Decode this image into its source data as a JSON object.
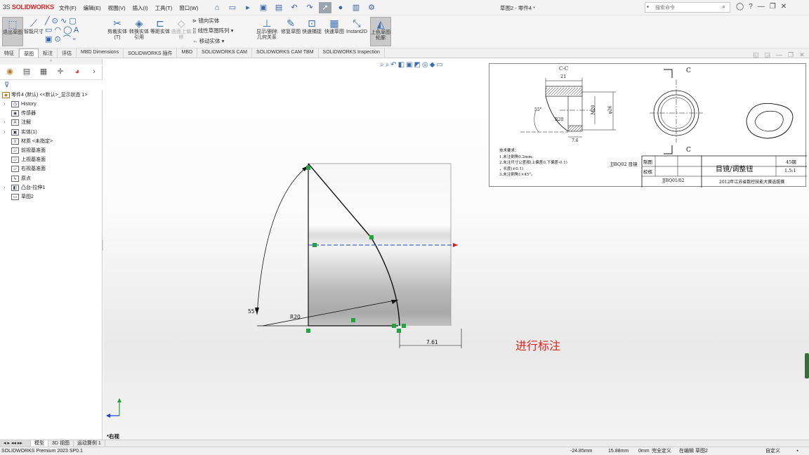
{
  "app": {
    "brand": "SOLIDWORKS",
    "logo_mark": "3S",
    "doc_title": "草图2 - 零件4 *"
  },
  "menu": [
    "文件(F)",
    "编辑(E)",
    "视图(V)",
    "插入(I)",
    "工具(T)",
    "窗口(W)"
  ],
  "search": {
    "placeholder": "搜索命令",
    "icon": "search-icon"
  },
  "ribbon": {
    "exit_sketch": "退出草图",
    "smart_dim": "智能尺寸",
    "trim": "剪裁实体(T)",
    "convert": "转换实体引用",
    "offset": "等距实体",
    "surface_offset": "曲面上偏移",
    "mirror": "镜向实体",
    "linear_array": "线性草图阵列",
    "move": "移动实体",
    "relations": "显示/删除几何关系",
    "repair": "修复草图",
    "quick_snaps": "快速捕捉",
    "rapid_sketch": "快速草图",
    "instant2d": "Instant2D",
    "shaded_contours": "上色草图轮廓"
  },
  "command_tabs": [
    "特征",
    "草图",
    "标注",
    "评估",
    "MBD Dimensions",
    "SOLIDWORKS 插件",
    "MBD",
    "SOLIDWORKS CAM",
    "SOLIDWORKS CAM TBM",
    "SOLIDWORKS Inspection"
  ],
  "active_command_tab": "草图",
  "feature_tree": {
    "root": "零件4 (默认) <<默认>_显示状态 1>",
    "items": [
      {
        "label": "History",
        "icon": "history-icon",
        "expandable": true
      },
      {
        "label": "传感器",
        "icon": "sensor-icon",
        "expandable": false
      },
      {
        "label": "注解",
        "icon": "annotation-icon",
        "expandable": true
      },
      {
        "label": "实体(1)",
        "icon": "solid-body-icon",
        "expandable": true
      },
      {
        "label": "材质 <未指定>",
        "icon": "material-icon",
        "expandable": false
      },
      {
        "label": "前视基准面",
        "icon": "plane-icon",
        "expandable": false
      },
      {
        "label": "上视基准面",
        "icon": "plane-icon",
        "expandable": false
      },
      {
        "label": "右视基准面",
        "icon": "plane-icon",
        "expandable": false
      },
      {
        "label": "原点",
        "icon": "origin-icon",
        "expandable": false
      },
      {
        "label": "凸台-拉伸1",
        "icon": "extrude-icon",
        "expandable": true
      },
      {
        "label": "草图2",
        "icon": "sketch-icon",
        "expandable": false
      }
    ]
  },
  "sketch": {
    "dim_angle": "55°",
    "dim_radius": "R20",
    "dim_length": "7.61"
  },
  "annotation_text": "进行标注",
  "reference_drawing": {
    "section_label": "C-C",
    "dim_top": "21",
    "dim_angle": "55°",
    "dim_radius": "R20",
    "dim_m20": "M20",
    "dim_dia": "φ26",
    "dim_bottom": "7.6",
    "view_label": "C",
    "notes": [
      "技术要求：",
      "1.未注倒角0.2mm。",
      "2.未注尺寸公差按(上偏差0,下偏差-0.1)",
      "，长度(±0.1)",
      "3.未注倒角1×45°。"
    ],
    "part_code": "JJBQ02 目镜",
    "row1": "制图",
    "row2": "校核",
    "part_name": "目镜/调整钮",
    "material": "45钢",
    "scale": "1.5:1",
    "drawing_no": "JJBQ01/02",
    "competition": "2012年江苏省数控技能大赛选拔赛"
  },
  "view_orientation": "*右视",
  "bottom_tabs": [
    "模型",
    "3D 视图",
    "运动算例 1"
  ],
  "status": {
    "product": "SOLIDWORKS Premium 2023 SP0.1",
    "x": "-24.85mm",
    "y": "15.88mm",
    "z": "0mm",
    "defined": "完全定义",
    "editing": "在编辑 草图2",
    "units": "自定义"
  },
  "colors": {
    "accent": "#3b6db3",
    "annotation": "#e0221d",
    "brand": "#d8262b",
    "sketch_green": "#1fa53a",
    "centerline_blue": "#1f3fd6"
  }
}
